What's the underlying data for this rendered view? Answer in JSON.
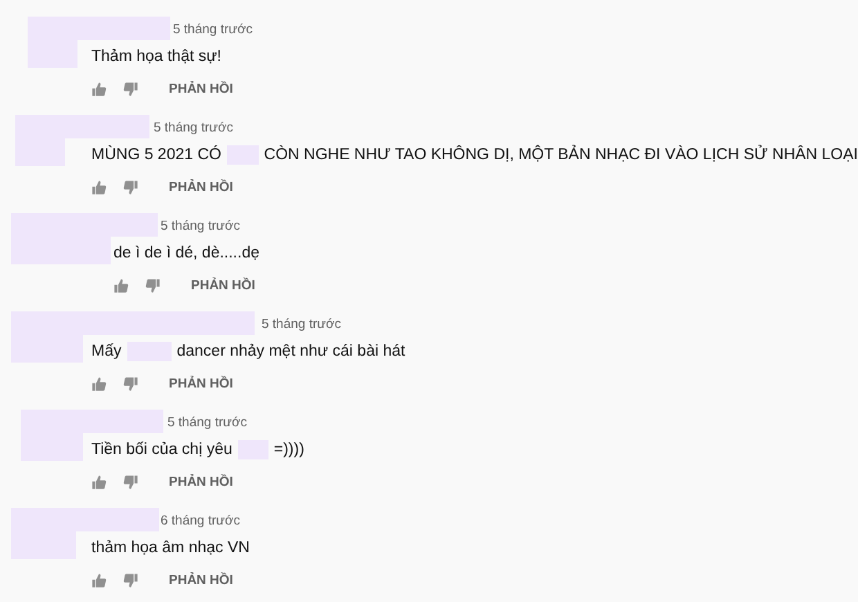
{
  "comments": [
    {
      "time": "5 tháng trước",
      "parts": [
        {
          "kind": "text",
          "text": "Thảm họa thật sự!"
        }
      ],
      "reply": "PHẢN HỒI"
    },
    {
      "time": "5 tháng trước",
      "parts": [
        {
          "kind": "text",
          "text": "MÙNG 5 2021 CÓ"
        },
        {
          "kind": "redacted"
        },
        {
          "kind": "text",
          "text": "CÒN NGHE NHƯ TAO KHÔNG DỊ, MỘT BẢN NHẠC ĐI VÀO LỊCH SỬ NHÂN LOẠI"
        }
      ],
      "reply": "PHẢN HỒI"
    },
    {
      "time": "5 tháng trước",
      "parts": [
        {
          "kind": "text",
          "text": "de ì de ì dé, dè.....dẹ"
        }
      ],
      "reply": "PHẢN HỒI"
    },
    {
      "time": "5 tháng trước",
      "parts": [
        {
          "kind": "text",
          "text": "Mấy"
        },
        {
          "kind": "redacted"
        },
        {
          "kind": "text",
          "text": "dancer nhảy mệt như cái bài hát"
        }
      ],
      "reply": "PHẢN HỒI"
    },
    {
      "time": "5 tháng trước",
      "parts": [
        {
          "kind": "text",
          "text": "Tiền bối của chị yêu"
        },
        {
          "kind": "redacted"
        },
        {
          "kind": "text",
          "text": "=))))"
        }
      ],
      "reply": "PHẢN HỒI"
    },
    {
      "time": "6 tháng trước",
      "parts": [
        {
          "kind": "text",
          "text": "thảm họa âm nhạc VN"
        }
      ],
      "reply": "PHẢN HỒI"
    }
  ]
}
